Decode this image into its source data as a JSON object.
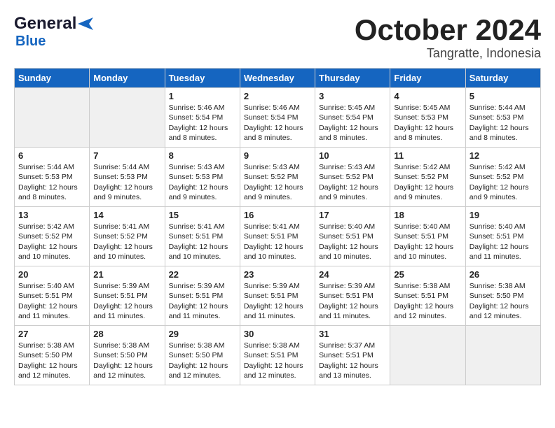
{
  "header": {
    "logo_general": "General",
    "logo_blue": "Blue",
    "month_title": "October 2024",
    "location": "Tangratte, Indonesia"
  },
  "days_of_week": [
    "Sunday",
    "Monday",
    "Tuesday",
    "Wednesday",
    "Thursday",
    "Friday",
    "Saturday"
  ],
  "weeks": [
    [
      {
        "day": null,
        "info": null
      },
      {
        "day": null,
        "info": null
      },
      {
        "day": "1",
        "info": "Sunrise: 5:46 AM\nSunset: 5:54 PM\nDaylight: 12 hours and 8 minutes."
      },
      {
        "day": "2",
        "info": "Sunrise: 5:46 AM\nSunset: 5:54 PM\nDaylight: 12 hours and 8 minutes."
      },
      {
        "day": "3",
        "info": "Sunrise: 5:45 AM\nSunset: 5:54 PM\nDaylight: 12 hours and 8 minutes."
      },
      {
        "day": "4",
        "info": "Sunrise: 5:45 AM\nSunset: 5:53 PM\nDaylight: 12 hours and 8 minutes."
      },
      {
        "day": "5",
        "info": "Sunrise: 5:44 AM\nSunset: 5:53 PM\nDaylight: 12 hours and 8 minutes."
      }
    ],
    [
      {
        "day": "6",
        "info": "Sunrise: 5:44 AM\nSunset: 5:53 PM\nDaylight: 12 hours and 8 minutes."
      },
      {
        "day": "7",
        "info": "Sunrise: 5:44 AM\nSunset: 5:53 PM\nDaylight: 12 hours and 9 minutes."
      },
      {
        "day": "8",
        "info": "Sunrise: 5:43 AM\nSunset: 5:53 PM\nDaylight: 12 hours and 9 minutes."
      },
      {
        "day": "9",
        "info": "Sunrise: 5:43 AM\nSunset: 5:52 PM\nDaylight: 12 hours and 9 minutes."
      },
      {
        "day": "10",
        "info": "Sunrise: 5:43 AM\nSunset: 5:52 PM\nDaylight: 12 hours and 9 minutes."
      },
      {
        "day": "11",
        "info": "Sunrise: 5:42 AM\nSunset: 5:52 PM\nDaylight: 12 hours and 9 minutes."
      },
      {
        "day": "12",
        "info": "Sunrise: 5:42 AM\nSunset: 5:52 PM\nDaylight: 12 hours and 9 minutes."
      }
    ],
    [
      {
        "day": "13",
        "info": "Sunrise: 5:42 AM\nSunset: 5:52 PM\nDaylight: 12 hours and 10 minutes."
      },
      {
        "day": "14",
        "info": "Sunrise: 5:41 AM\nSunset: 5:52 PM\nDaylight: 12 hours and 10 minutes."
      },
      {
        "day": "15",
        "info": "Sunrise: 5:41 AM\nSunset: 5:51 PM\nDaylight: 12 hours and 10 minutes."
      },
      {
        "day": "16",
        "info": "Sunrise: 5:41 AM\nSunset: 5:51 PM\nDaylight: 12 hours and 10 minutes."
      },
      {
        "day": "17",
        "info": "Sunrise: 5:40 AM\nSunset: 5:51 PM\nDaylight: 12 hours and 10 minutes."
      },
      {
        "day": "18",
        "info": "Sunrise: 5:40 AM\nSunset: 5:51 PM\nDaylight: 12 hours and 10 minutes."
      },
      {
        "day": "19",
        "info": "Sunrise: 5:40 AM\nSunset: 5:51 PM\nDaylight: 12 hours and 11 minutes."
      }
    ],
    [
      {
        "day": "20",
        "info": "Sunrise: 5:40 AM\nSunset: 5:51 PM\nDaylight: 12 hours and 11 minutes."
      },
      {
        "day": "21",
        "info": "Sunrise: 5:39 AM\nSunset: 5:51 PM\nDaylight: 12 hours and 11 minutes."
      },
      {
        "day": "22",
        "info": "Sunrise: 5:39 AM\nSunset: 5:51 PM\nDaylight: 12 hours and 11 minutes."
      },
      {
        "day": "23",
        "info": "Sunrise: 5:39 AM\nSunset: 5:51 PM\nDaylight: 12 hours and 11 minutes."
      },
      {
        "day": "24",
        "info": "Sunrise: 5:39 AM\nSunset: 5:51 PM\nDaylight: 12 hours and 11 minutes."
      },
      {
        "day": "25",
        "info": "Sunrise: 5:38 AM\nSunset: 5:51 PM\nDaylight: 12 hours and 12 minutes."
      },
      {
        "day": "26",
        "info": "Sunrise: 5:38 AM\nSunset: 5:50 PM\nDaylight: 12 hours and 12 minutes."
      }
    ],
    [
      {
        "day": "27",
        "info": "Sunrise: 5:38 AM\nSunset: 5:50 PM\nDaylight: 12 hours and 12 minutes."
      },
      {
        "day": "28",
        "info": "Sunrise: 5:38 AM\nSunset: 5:50 PM\nDaylight: 12 hours and 12 minutes."
      },
      {
        "day": "29",
        "info": "Sunrise: 5:38 AM\nSunset: 5:50 PM\nDaylight: 12 hours and 12 minutes."
      },
      {
        "day": "30",
        "info": "Sunrise: 5:38 AM\nSunset: 5:51 PM\nDaylight: 12 hours and 12 minutes."
      },
      {
        "day": "31",
        "info": "Sunrise: 5:37 AM\nSunset: 5:51 PM\nDaylight: 12 hours and 13 minutes."
      },
      {
        "day": null,
        "info": null
      },
      {
        "day": null,
        "info": null
      }
    ]
  ]
}
